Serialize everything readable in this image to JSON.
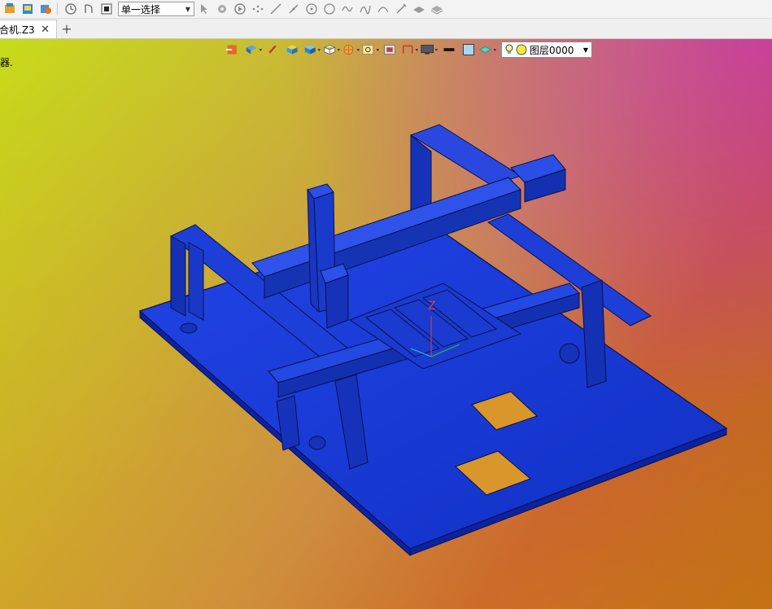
{
  "toolbar": {
    "select_mode": "单一选择",
    "icons": [
      "new-file-icon",
      "open-file-icon",
      "save-file-icon",
      "rotate-icon",
      "undo-icon",
      "stop-icon"
    ],
    "draw_icons": [
      "cursor-icon",
      "pick-icon",
      "play-icon",
      "points-icon",
      "line-icon",
      "segment-icon",
      "circle-point-icon",
      "circle-icon",
      "curve-icon",
      "spline-icon",
      "arc-icon",
      "pencil-line-icon",
      "plane-icon",
      "layers-stack-icon"
    ]
  },
  "tabs": {
    "active_label": "合机.Z3",
    "close_symbol": "✕",
    "add_symbol": "+"
  },
  "viewport": {
    "hint": "器.",
    "layer": "图层0000",
    "axis_label": "Z",
    "colors": {
      "model": "#1a3ad6",
      "model_dark": "#0d1f8c",
      "bg_top_left": "#c7dc19",
      "bg_top_right": "#c83aa0",
      "bg_bottom": "#b6601e"
    }
  }
}
